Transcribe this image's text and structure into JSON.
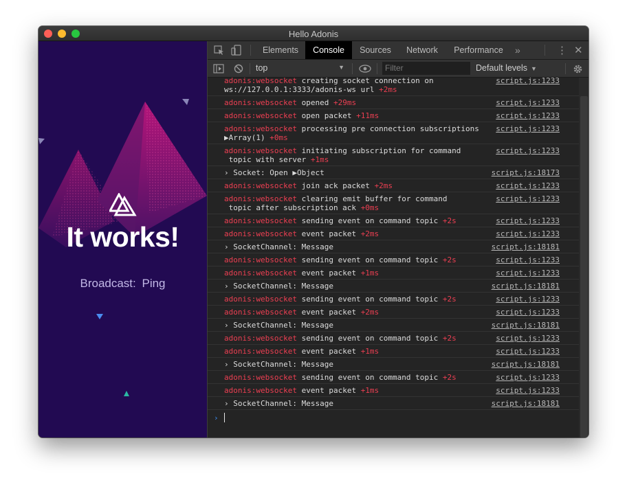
{
  "window": {
    "title": "Hello Adonis"
  },
  "app": {
    "heading": "It works!",
    "broadcast_label": "Broadcast:",
    "broadcast_value": "Ping",
    "colors": {
      "background": "#220a52",
      "accent_pink": "#c01a73",
      "accent_teal": "#2bb7a3"
    }
  },
  "devtools": {
    "tabs": [
      {
        "label": "Elements",
        "active": false
      },
      {
        "label": "Console",
        "active": true
      },
      {
        "label": "Sources",
        "active": false
      },
      {
        "label": "Network",
        "active": false
      },
      {
        "label": "Performance",
        "active": false
      }
    ],
    "toolbar": {
      "context": "top",
      "filter_placeholder": "Filter",
      "levels": "Default levels"
    },
    "console_rows": [
      {
        "ns": "adonis:websocket",
        "lines": [
          " creating socket connection on",
          "ws://127.0.0.1:3333/adonis-ws url"
        ],
        "time": "+2ms",
        "ref": "script.js:1233"
      },
      {
        "ns": "adonis:websocket",
        "lines": [
          " opened"
        ],
        "time": "+29ms",
        "ref": "script.js:1233"
      },
      {
        "ns": "adonis:websocket",
        "lines": [
          " open packet"
        ],
        "time": "+11ms",
        "ref": "script.js:1233"
      },
      {
        "ns": "adonis:websocket",
        "lines": [
          " processing pre connection subscriptions",
          "▶Array(1)"
        ],
        "time": "+0ms",
        "ref": "script.js:1233"
      },
      {
        "ns": "adonis:websocket",
        "lines": [
          " initiating subscription for command",
          " topic with server"
        ],
        "time": "+1ms",
        "ref": "script.js:1233"
      },
      {
        "plain": "› Socket: Open ▶Object",
        "ref": "script.js:18173"
      },
      {
        "ns": "adonis:websocket",
        "lines": [
          " join ack packet"
        ],
        "time": "+2ms",
        "ref": "script.js:1233"
      },
      {
        "ns": "adonis:websocket",
        "lines": [
          " clearing emit buffer for command",
          " topic after subscription ack"
        ],
        "time": "+0ms",
        "ref": "script.js:1233"
      },
      {
        "ns": "adonis:websocket",
        "lines": [
          " sending event on command topic"
        ],
        "time": "+2s",
        "ref": "script.js:1233"
      },
      {
        "ns": "adonis:websocket",
        "lines": [
          " event packet"
        ],
        "time": "+2ms",
        "ref": "script.js:1233"
      },
      {
        "plain": "› SocketChannel: Message",
        "ref": "script.js:18181"
      },
      {
        "ns": "adonis:websocket",
        "lines": [
          " sending event on command topic"
        ],
        "time": "+2s",
        "ref": "script.js:1233"
      },
      {
        "ns": "adonis:websocket",
        "lines": [
          " event packet"
        ],
        "time": "+1ms",
        "ref": "script.js:1233"
      },
      {
        "plain": "› SocketChannel: Message",
        "ref": "script.js:18181"
      },
      {
        "ns": "adonis:websocket",
        "lines": [
          " sending event on command topic"
        ],
        "time": "+2s",
        "ref": "script.js:1233"
      },
      {
        "ns": "adonis:websocket",
        "lines": [
          " event packet"
        ],
        "time": "+2ms",
        "ref": "script.js:1233"
      },
      {
        "plain": "› SocketChannel: Message",
        "ref": "script.js:18181"
      },
      {
        "ns": "adonis:websocket",
        "lines": [
          " sending event on command topic"
        ],
        "time": "+2s",
        "ref": "script.js:1233"
      },
      {
        "ns": "adonis:websocket",
        "lines": [
          " event packet"
        ],
        "time": "+1ms",
        "ref": "script.js:1233"
      },
      {
        "plain": "› SocketChannel: Message",
        "ref": "script.js:18181"
      },
      {
        "ns": "adonis:websocket",
        "lines": [
          " sending event on command topic"
        ],
        "time": "+2s",
        "ref": "script.js:1233"
      },
      {
        "ns": "adonis:websocket",
        "lines": [
          " event packet"
        ],
        "time": "+1ms",
        "ref": "script.js:1233"
      },
      {
        "plain": "› SocketChannel: Message",
        "ref": "script.js:18181"
      }
    ],
    "prompt": "›"
  }
}
